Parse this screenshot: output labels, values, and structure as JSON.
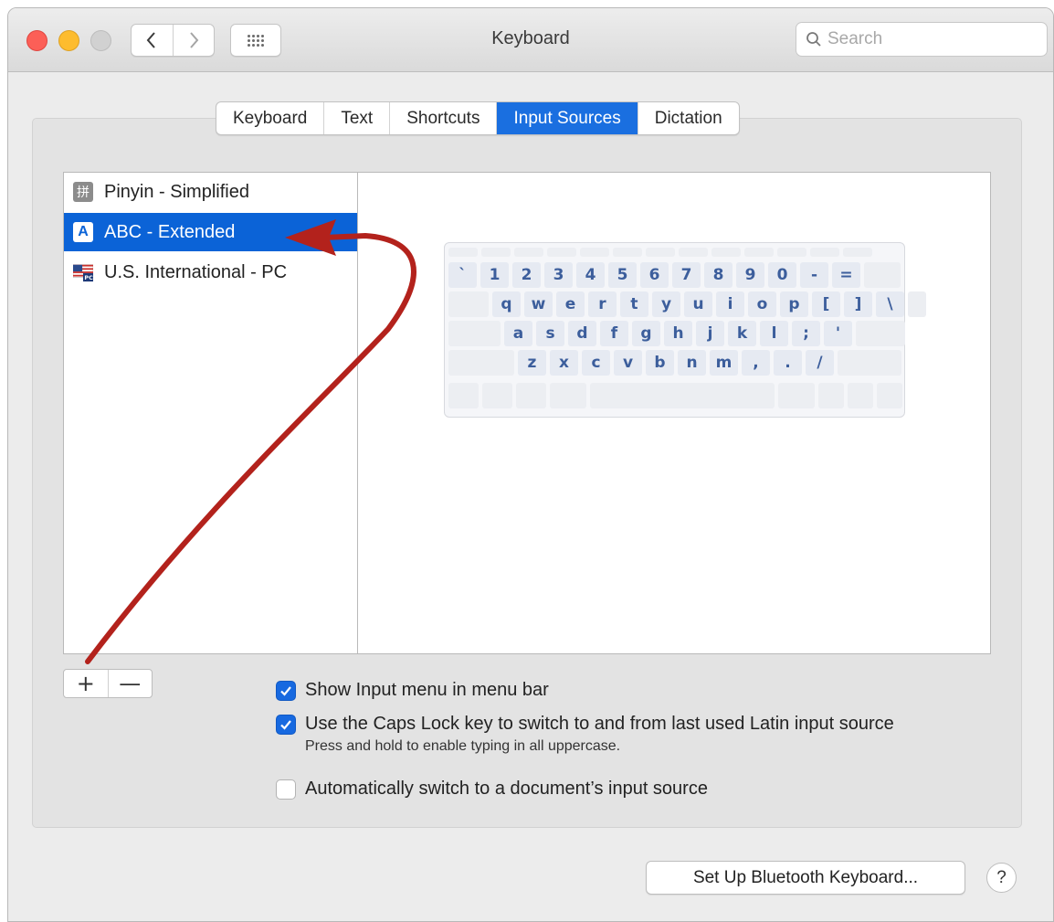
{
  "window": {
    "title": "Keyboard"
  },
  "toolbar": {
    "search_placeholder": "Search"
  },
  "tabs": [
    {
      "label": "Keyboard",
      "active": false
    },
    {
      "label": "Text",
      "active": false
    },
    {
      "label": "Shortcuts",
      "active": false
    },
    {
      "label": "Input Sources",
      "active": true
    },
    {
      "label": "Dictation",
      "active": false
    }
  ],
  "sources": [
    {
      "label": "Pinyin - Simplified",
      "icon": "pinyin-icon",
      "icon_glyph": "拼",
      "selected": false
    },
    {
      "label": "ABC - Extended",
      "icon": "abc-icon",
      "icon_glyph": "A",
      "selected": true
    },
    {
      "label": "U.S. International - PC",
      "icon": "us-flag-icon",
      "icon_glyph": "",
      "selected": false
    }
  ],
  "keyboard": {
    "row1": [
      "`",
      "1",
      "2",
      "3",
      "4",
      "5",
      "6",
      "7",
      "8",
      "9",
      "0",
      "-",
      "="
    ],
    "row2": [
      "q",
      "w",
      "e",
      "r",
      "t",
      "y",
      "u",
      "i",
      "o",
      "p",
      "[",
      "]",
      "\\"
    ],
    "row3": [
      "a",
      "s",
      "d",
      "f",
      "g",
      "h",
      "j",
      "k",
      "l",
      ";",
      "'"
    ],
    "row4": [
      "z",
      "x",
      "c",
      "v",
      "b",
      "n",
      "m",
      ",",
      ".",
      "/"
    ]
  },
  "buttons": {
    "add": "+",
    "remove": "—",
    "bluetooth": "Set Up Bluetooth Keyboard...",
    "help": "?"
  },
  "options": {
    "show_input_menu": {
      "label": "Show Input menu in menu bar",
      "checked": true
    },
    "caps_lock": {
      "label": "Use the Caps Lock key to switch to and from last used Latin input source",
      "checked": true
    },
    "caps_lock_note": "Press and hold to enable typing in all uppercase.",
    "auto_switch": {
      "label": "Automatically switch to a document’s input source",
      "checked": false
    }
  },
  "colors": {
    "accent": "#0b63d7",
    "arrow": "#b3221c",
    "key_text": "#3c5e9c"
  }
}
